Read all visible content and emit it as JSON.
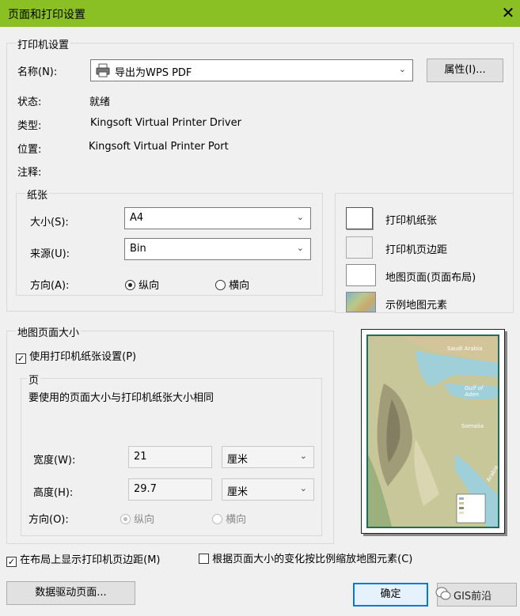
{
  "window": {
    "title": "页面和打印设置"
  },
  "printer": {
    "group_label": "打印机设置",
    "name_label": "名称(N):",
    "name_value": "导出为WPS PDF",
    "properties_button": "属性(I)...",
    "status_label": "状态:",
    "status_value": "就绪",
    "type_label": "类型:",
    "type_value": "Kingsoft Virtual Printer Driver",
    "where_label": "位置:",
    "where_value": "Kingsoft Virtual Printer Port",
    "comment_label": "注释:"
  },
  "paper": {
    "group_label": "纸张",
    "size_label": "大小(S):",
    "size_value": "A4",
    "source_label": "来源(U):",
    "source_value": "Bin",
    "orientation_label": "方向(A):",
    "portrait_label": "纵向",
    "landscape_label": "横向",
    "orientation_selected": "portrait"
  },
  "legend": {
    "printer_paper": "打印机纸张",
    "printer_margins": "打印机页边距",
    "map_page": "地图页面(页面布局)",
    "sample_elements": "示例地图元素"
  },
  "map_page_size": {
    "group_label": "地图页面大小",
    "use_printer_paper": "使用打印机纸张设置(P)",
    "use_printer_paper_checked": true,
    "page_group_label": "页",
    "page_note": "要使用的页面大小与打印机纸张大小相同",
    "width_label": "宽度(W):",
    "width_value": "21",
    "width_unit": "厘米",
    "height_label": "高度(H):",
    "height_value": "29.7",
    "height_unit": "厘米",
    "orientation_label": "方向(O):",
    "portrait_label": "纵向",
    "landscape_label": "横向"
  },
  "preview_map": {
    "labels": [
      "Saudi Arabia",
      "Gulf of Aden",
      "Somalia",
      "Arabia"
    ]
  },
  "options": {
    "show_margins": "在布局上显示打印机页边距(M)",
    "show_margins_checked": true,
    "scale_elements": "根据页面大小的变化按比例缩放地图元素(C)",
    "scale_elements_checked": false
  },
  "buttons": {
    "data_driven": "数据驱动页面...",
    "ok": "确定"
  },
  "watermark": {
    "text": "GIS前沿"
  },
  "colors": {
    "titlebar": "#8ac024",
    "accent": "#0078d7",
    "map_border": "#1c6f5c"
  }
}
